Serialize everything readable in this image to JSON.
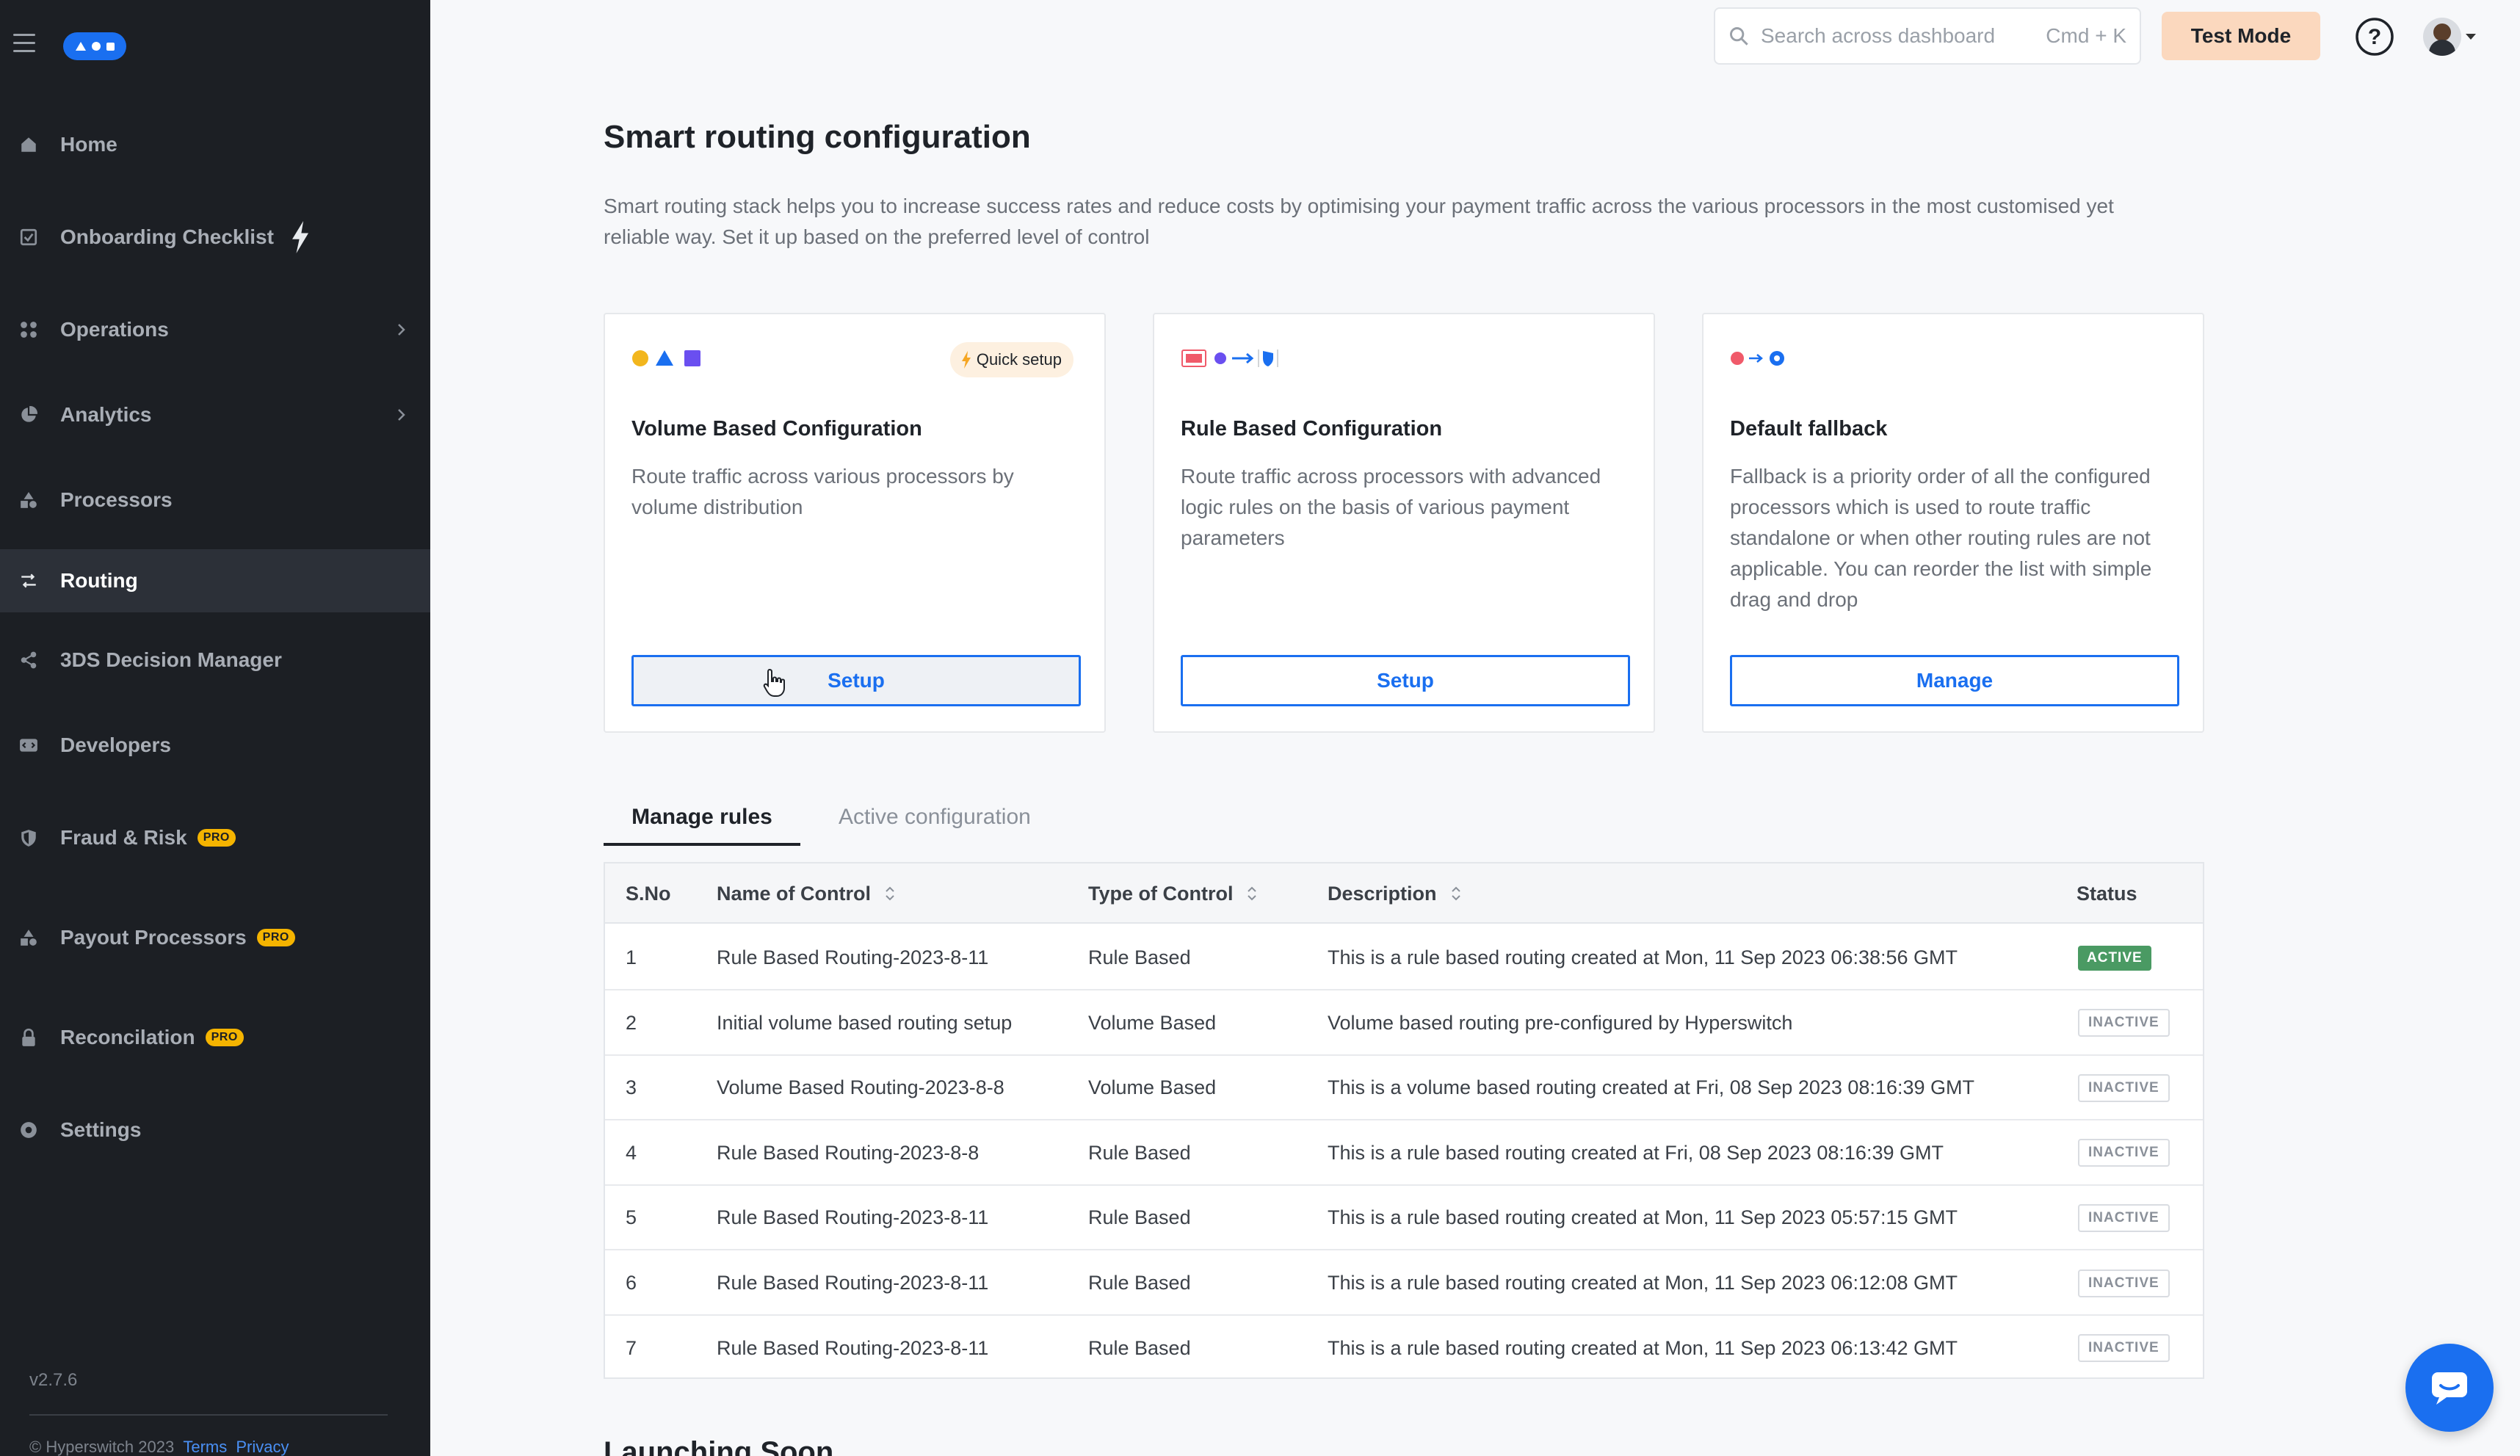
{
  "app": {
    "brand_color": "#1a6ff0",
    "version": "v2.7.6",
    "footer": {
      "copyright": "Hyperswitch 2023",
      "terms": "Terms",
      "privacy": "Privacy"
    }
  },
  "sidebar": {
    "items": [
      {
        "label": "Home",
        "icon": "home-icon"
      },
      {
        "label": "Onboarding Checklist",
        "icon": "checklist-icon"
      },
      {
        "label": "Operations",
        "icon": "grid-icon"
      },
      {
        "label": "Analytics",
        "icon": "pie-chart-icon"
      },
      {
        "label": "Processors",
        "icon": "shapes-icon"
      },
      {
        "label": "Routing",
        "icon": "routing-icon",
        "active": true
      },
      {
        "label": "3DS Decision Manager",
        "icon": "share-icon"
      },
      {
        "label": "Developers",
        "icon": "code-icon"
      },
      {
        "label": "Fraud & Risk",
        "icon": "shield-icon",
        "badge": "PRO"
      },
      {
        "label": "Payout Processors",
        "icon": "shapes-icon",
        "badge": "PRO"
      },
      {
        "label": "Reconcilation",
        "icon": "lock-icon",
        "badge": "PRO"
      },
      {
        "label": "Settings",
        "icon": "gear-icon"
      }
    ]
  },
  "header": {
    "search": {
      "placeholder": "Search across dashboard",
      "shortcut": "Cmd + K"
    },
    "test_mode_label": "Test Mode"
  },
  "main": {
    "title": "Smart routing configuration",
    "description": "Smart routing stack helps you to increase success rates and reduce costs by optimising your payment traffic across the various processors in the most customised yet reliable way. Set it up based on the preferred level of control",
    "cards": [
      {
        "title": "Volume Based Configuration",
        "description": "Route traffic across various processors by volume distribution",
        "button": "Setup",
        "tag": "Quick setup"
      },
      {
        "title": "Rule Based Configuration",
        "description": "Route traffic across processors with advanced logic rules on the basis of various payment parameters",
        "button": "Setup"
      },
      {
        "title": "Default fallback",
        "description": "Fallback is a priority order of all the configured processors which is used to route traffic standalone or when other routing rules are not applicable. You can reorder the list with simple drag and drop",
        "button": "Manage"
      }
    ],
    "tabs": [
      {
        "label": "Manage rules",
        "active": true
      },
      {
        "label": "Active configuration",
        "active": false
      }
    ],
    "table": {
      "headers": [
        "S.No",
        "Name of Control",
        "Type of Control",
        "Description",
        "Status"
      ],
      "rows": [
        {
          "sno": "1",
          "name": "Rule Based Routing-2023-8-11",
          "type": "Rule Based",
          "description": "This is a rule based routing created at Mon, 11 Sep 2023 06:38:56 GMT",
          "status": "ACTIVE"
        },
        {
          "sno": "2",
          "name": "Initial volume based routing setup",
          "type": "Volume Based",
          "description": "Volume based routing pre-configured by Hyperswitch",
          "status": "INACTIVE"
        },
        {
          "sno": "3",
          "name": "Volume Based Routing-2023-8-8",
          "type": "Volume Based",
          "description": "This is a volume based routing created at Fri, 08 Sep 2023 08:16:39 GMT",
          "status": "INACTIVE"
        },
        {
          "sno": "4",
          "name": "Rule Based Routing-2023-8-8",
          "type": "Rule Based",
          "description": "This is a rule based routing created at Fri, 08 Sep 2023 08:16:39 GMT",
          "status": "INACTIVE"
        },
        {
          "sno": "5",
          "name": "Rule Based Routing-2023-8-11",
          "type": "Rule Based",
          "description": "This is a rule based routing created at Mon, 11 Sep 2023 05:57:15 GMT",
          "status": "INACTIVE"
        },
        {
          "sno": "6",
          "name": "Rule Based Routing-2023-8-11",
          "type": "Rule Based",
          "description": "This is a rule based routing created at Mon, 11 Sep 2023 06:12:08 GMT",
          "status": "INACTIVE"
        },
        {
          "sno": "7",
          "name": "Rule Based Routing-2023-8-11",
          "type": "Rule Based",
          "description": "This is a rule based routing created at Mon, 11 Sep 2023 06:13:42 GMT",
          "status": "INACTIVE"
        }
      ]
    },
    "next_section_title": "Launching Soon"
  }
}
